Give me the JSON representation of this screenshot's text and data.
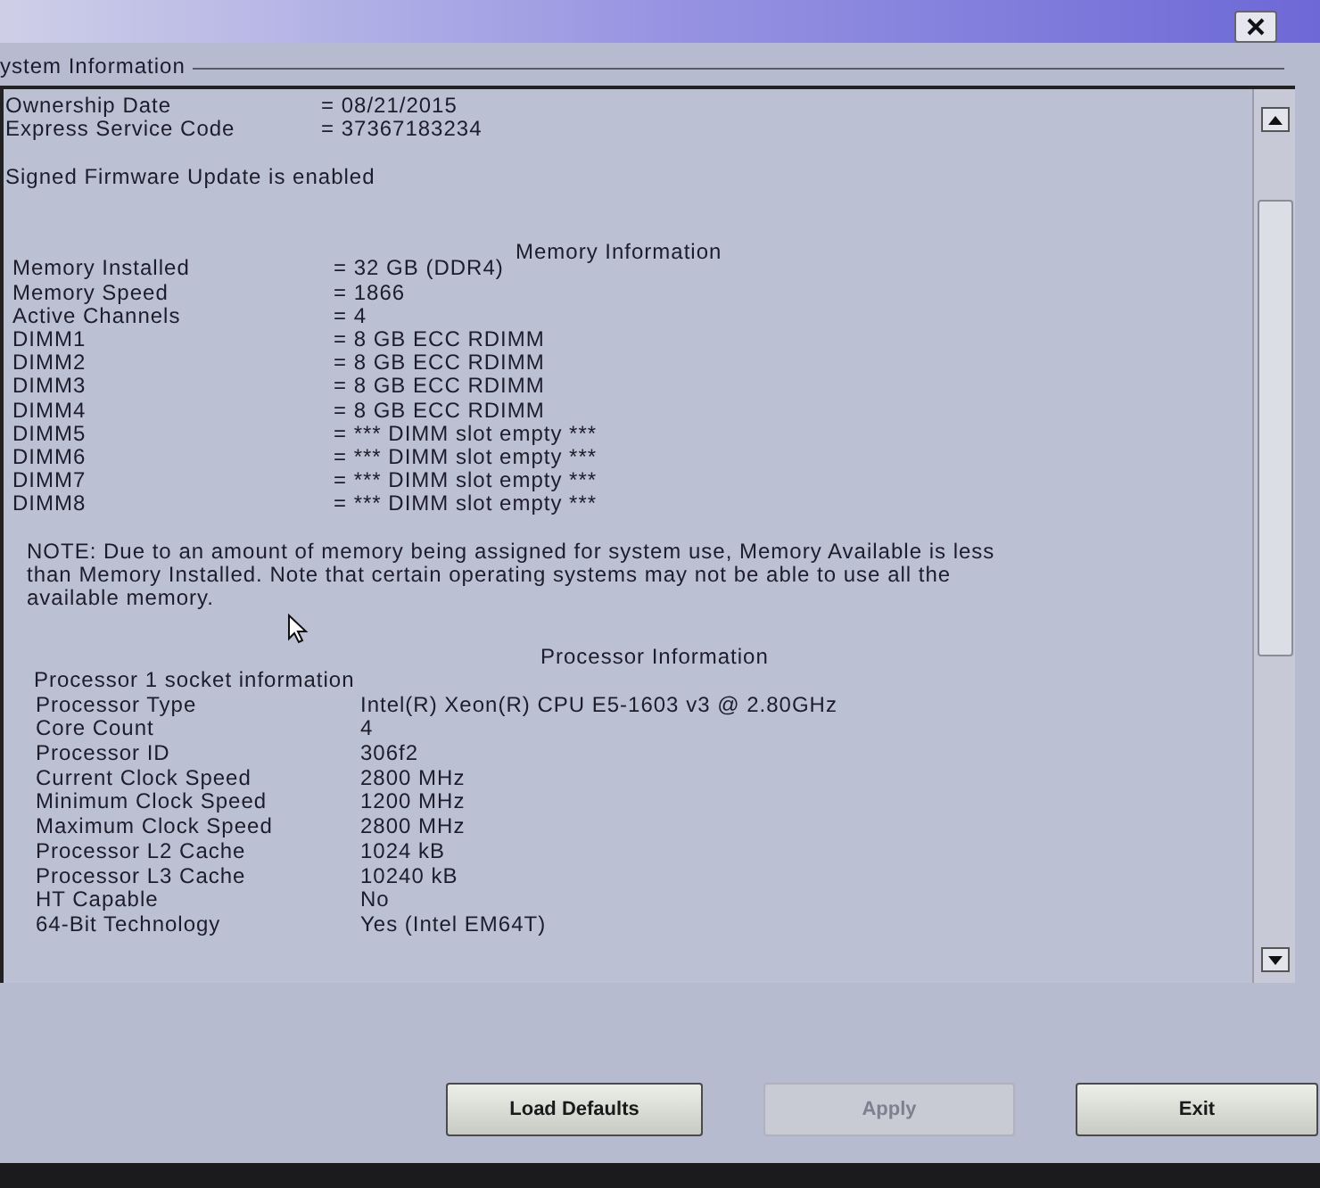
{
  "window": {
    "close_button": {
      "disabled": false
    }
  },
  "group_title": "ystem Information",
  "system_rows": [
    {
      "label": "Ownership Date",
      "value": "= 08/21/2015"
    },
    {
      "label": "Express Service Code",
      "value": "= 37367183234"
    }
  ],
  "firmware_notice": "Signed Firmware Update is enabled",
  "memory": {
    "heading": "Memory Information",
    "rows": [
      {
        "label": "Memory Installed",
        "value": "= 32 GB (DDR4)"
      },
      {
        "label": "Memory Speed",
        "value": "= 1866"
      },
      {
        "label": "Active Channels",
        "value": "= 4"
      },
      {
        "label": "DIMM1",
        "value": "= 8 GB ECC RDIMM"
      },
      {
        "label": "DIMM2",
        "value": "= 8 GB ECC RDIMM"
      },
      {
        "label": "DIMM3",
        "value": "= 8 GB ECC RDIMM"
      },
      {
        "label": "DIMM4",
        "value": "= 8 GB ECC RDIMM"
      },
      {
        "label": "DIMM5",
        "value": "= *** DIMM slot empty ***"
      },
      {
        "label": "DIMM6",
        "value": "= *** DIMM slot empty ***"
      },
      {
        "label": "DIMM7",
        "value": "= *** DIMM slot empty ***"
      },
      {
        "label": "DIMM8",
        "value": "= *** DIMM slot empty ***"
      }
    ]
  },
  "note": "NOTE: Due to an amount of memory being assigned for system use, Memory Available is less than Memory Installed. Note that certain operating systems may not be able to use all the available memory.",
  "processor": {
    "heading": "Processor Information",
    "subheading": "Processor 1 socket information",
    "rows": [
      {
        "label": "Processor Type",
        "value": "Intel(R) Xeon(R) CPU E5-1603 v3 @ 2.80GHz"
      },
      {
        "label": "Core Count",
        "value": "4"
      },
      {
        "label": "Processor ID",
        "value": "306f2"
      },
      {
        "label": "Current Clock Speed",
        "value": "2800 MHz"
      },
      {
        "label": "Minimum Clock Speed",
        "value": "1200 MHz"
      },
      {
        "label": "Maximum Clock Speed",
        "value": "2800 MHz"
      },
      {
        "label": "Processor L2 Cache",
        "value": "1024 kB"
      },
      {
        "label": "Processor L3 Cache",
        "value": "10240 kB"
      },
      {
        "label": "HT Capable",
        "value": "No"
      },
      {
        "label": "64-Bit Technology",
        "value": "Yes (Intel EM64T)"
      }
    ]
  },
  "buttons": [
    {
      "label": "Load Defaults",
      "disabled": false
    },
    {
      "label": "Apply",
      "disabled": true
    },
    {
      "label": "Exit",
      "disabled": false
    }
  ]
}
